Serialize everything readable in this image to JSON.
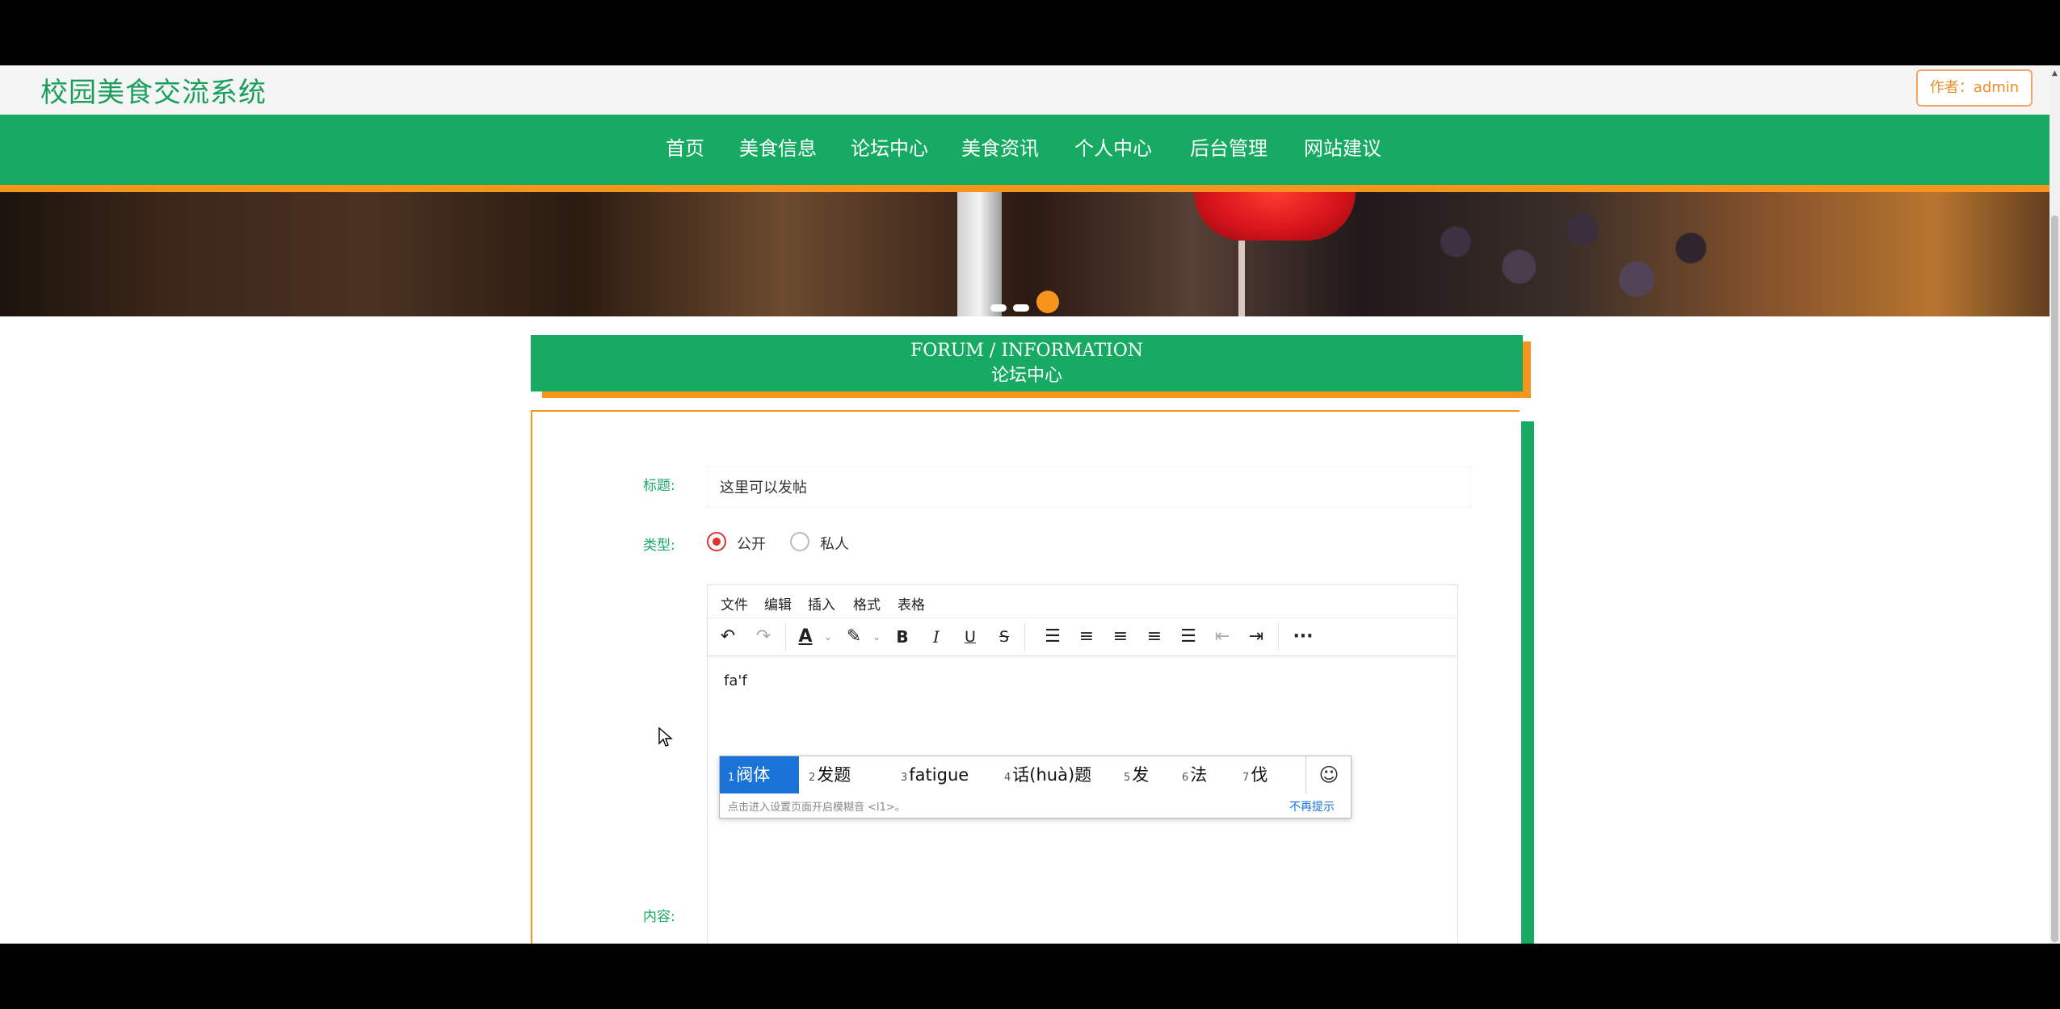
{
  "header": {
    "site_title": "校园美食交流系统",
    "author_button": "作者：admin"
  },
  "nav": {
    "items": [
      {
        "label": "首页"
      },
      {
        "label": "美食信息"
      },
      {
        "label": "论坛中心"
      },
      {
        "label": "美食资讯"
      },
      {
        "label": "个人中心"
      },
      {
        "label": "后台管理"
      },
      {
        "label": "网站建议"
      }
    ]
  },
  "section": {
    "title_en": "FORUM / INFORMATION",
    "title_cn": "论坛中心"
  },
  "form": {
    "title_label": "标题:",
    "title_value": "这里可以发帖",
    "type_label": "类型:",
    "type_options": [
      "公开",
      "私人"
    ],
    "type_selected": "公开",
    "content_label": "内容:"
  },
  "editor": {
    "menu": [
      "文件",
      "编辑",
      "插入",
      "格式",
      "表格"
    ],
    "toolbar_icons": [
      "undo-icon",
      "redo-icon",
      "font-color-icon",
      "highlight-icon",
      "bold-icon",
      "italic-icon",
      "underline-icon",
      "strikethrough-icon",
      "line-height-icon",
      "align-left-icon",
      "align-center-icon",
      "align-right-icon",
      "align-justify-icon",
      "outdent-icon",
      "indent-icon",
      "more-icon"
    ],
    "typed_text": "fa'f"
  },
  "ime": {
    "candidates": [
      {
        "num": "1",
        "text": "阀体"
      },
      {
        "num": "2",
        "text": "发题"
      },
      {
        "num": "3",
        "text": "fatigue"
      },
      {
        "num": "4",
        "text": "话(huà)题"
      },
      {
        "num": "5",
        "text": "发"
      },
      {
        "num": "6",
        "text": "法"
      },
      {
        "num": "7",
        "text": "伐"
      }
    ],
    "hint": "点击进入设置页面开启模糊音 <l1>。",
    "no_more": "不再提示",
    "emoji_icon": "emoji-icon"
  },
  "colors": {
    "brand_green": "#17aa63",
    "accent_orange": "#f7941d",
    "ime_blue": "#1a73d9"
  }
}
